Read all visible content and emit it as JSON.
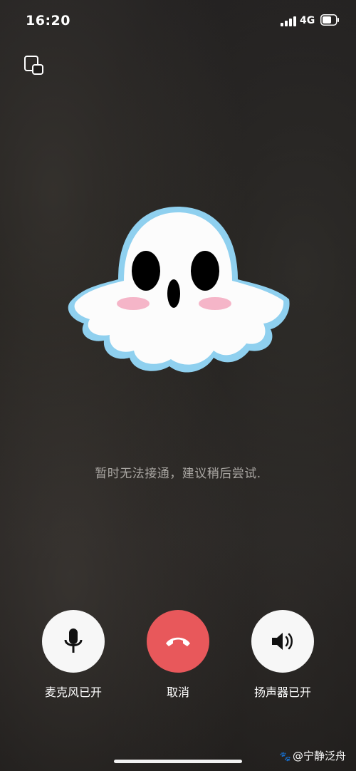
{
  "status": {
    "time": "16:20",
    "network": "4G"
  },
  "message": "暂时无法接通，建议稍后尝试.",
  "controls": {
    "mic_label": "麦克风已开",
    "cancel_label": "取消",
    "speaker_label": "扬声器已开"
  },
  "watermark": {
    "text": "@宁静泛舟"
  },
  "icons": {
    "pip": "picture-in-picture-icon",
    "mic": "microphone-icon",
    "cancel": "hang-up-icon",
    "speaker": "speaker-icon",
    "avatar": "ghost-avatar"
  },
  "colors": {
    "hangup": "#e8585b",
    "button_bg": "#f7f7f7",
    "ghost_outline": "#8fd0ef",
    "blush": "#f5b5c8"
  }
}
